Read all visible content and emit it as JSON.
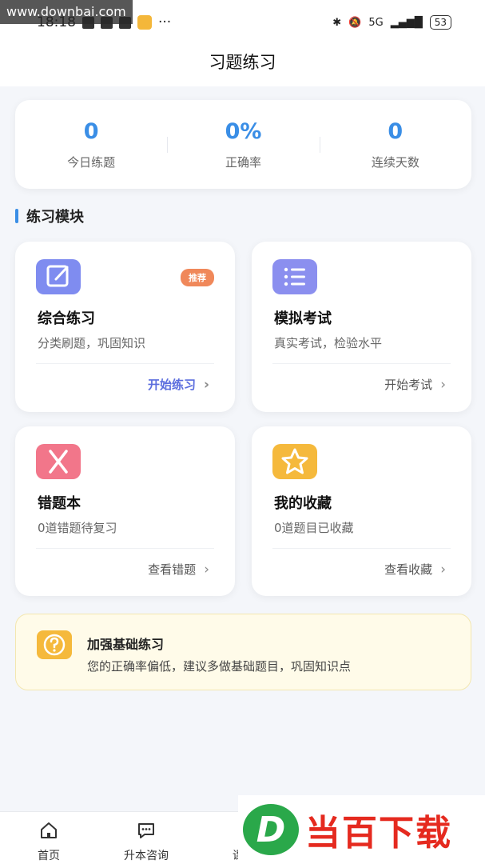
{
  "status_bar": {
    "time": "18:18",
    "network": "5G",
    "battery": "53"
  },
  "watermark": "www.downbai.com",
  "header": {
    "title": "习题练习"
  },
  "stats": [
    {
      "value": "0",
      "label": "今日练题"
    },
    {
      "value": "0%",
      "label": "正确率"
    },
    {
      "value": "0",
      "label": "连续天数"
    }
  ],
  "section": {
    "title": "练习模块"
  },
  "modules": [
    {
      "title": "综合练习",
      "desc": "分类刷题，巩固知识",
      "action": "开始练习",
      "badge": "推荐",
      "icon": "edit-icon",
      "color": "#7f8cf0"
    },
    {
      "title": "模拟考试",
      "desc": "真实考试，检验水平",
      "action": "开始考试",
      "icon": "list-icon",
      "color": "#8b8fef"
    },
    {
      "title": "错题本",
      "desc": "0道错题待复习",
      "action": "查看错题",
      "icon": "close-icon",
      "color": "#f2768a"
    },
    {
      "title": "我的收藏",
      "desc": "0道题目已收藏",
      "action": "查看收藏",
      "icon": "star-icon",
      "color": "#f5b93c"
    }
  ],
  "tip": {
    "title": "加强基础练习",
    "text": "您的正确率偏低，建议多做基础题目，巩固知识点",
    "icon": "question-icon"
  },
  "nav": [
    {
      "label": "首页",
      "icon": "home-icon"
    },
    {
      "label": "升本咨询",
      "icon": "chat-icon"
    },
    {
      "label": "课程",
      "icon": "course-icon"
    }
  ],
  "logo": {
    "mark": "D",
    "text": "当百下载"
  }
}
